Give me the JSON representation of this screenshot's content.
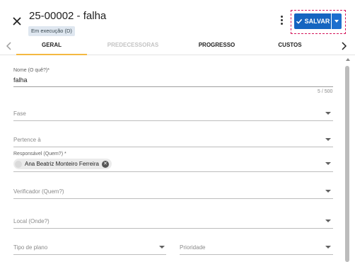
{
  "header": {
    "title": "25-00002 - falha",
    "status_badge": "Em execução (D)",
    "save_label": "SALVAR"
  },
  "tabs": [
    {
      "label": "GERAL",
      "state": "active"
    },
    {
      "label": "PREDECESSORAS",
      "state": "disabled"
    },
    {
      "label": "PROGRESSO",
      "state": "normal"
    },
    {
      "label": "CUSTOS",
      "state": "normal"
    }
  ],
  "form": {
    "name": {
      "label": "Nome (O quê?)*",
      "value": "falha",
      "counter": "5 / 500"
    },
    "phase": {
      "placeholder": "Fase"
    },
    "belongs_to": {
      "placeholder": "Pertence à"
    },
    "responsible": {
      "label": "Responsável (Quem?) *",
      "chip": "Ana Beatriz Monteiro Ferreira"
    },
    "verifier": {
      "placeholder": "Verificador (Quem?)"
    },
    "location": {
      "placeholder": "Local (Onde?)"
    },
    "plan_type": {
      "placeholder": "Tipo de plano"
    },
    "priority": {
      "placeholder": "Prioridade"
    }
  },
  "colors": {
    "primary": "#1565c0",
    "tab_indicator": "#f4b942",
    "focus_outline": "#d4145a"
  },
  "icons": [
    "close-icon",
    "more-vert-icon",
    "check-icon",
    "chevron-left-icon",
    "chevron-right-icon",
    "cancel-chip-icon"
  ]
}
